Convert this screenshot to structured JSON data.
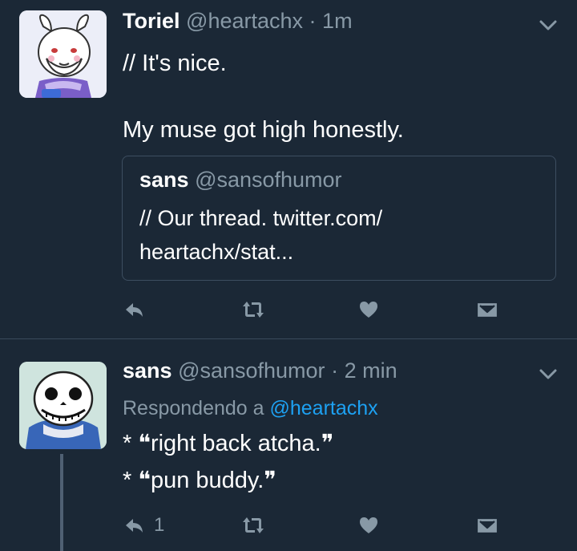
{
  "tweets": [
    {
      "name": "Toriel",
      "handle": "@heartachx",
      "separator": "·",
      "time": "1m",
      "text_line1": "// It's nice.",
      "text_line2": "My muse got high honestly.",
      "quote": {
        "name": "sans",
        "handle": "@sansofhumor",
        "text_line1": "// Our thread. twitter.com/",
        "text_line2": "heartachx/stat..."
      }
    },
    {
      "name": "sans",
      "handle": "@sansofhumor",
      "separator": "·",
      "time": "2 min",
      "reply_prefix": "Respondendo a",
      "reply_mention": "@heartachx",
      "text_line1": "* ❝right back atcha.❞",
      "text_line2": "* ❝pun buddy.❞",
      "reply_count": "1"
    }
  ],
  "icons": [
    "chevron-down-icon",
    "reply-icon",
    "retweet-icon",
    "heart-icon",
    "direct-message-icon"
  ],
  "colors": {
    "background": "#1b2836",
    "secondary_text": "#8899a6",
    "link": "#1da1f2"
  }
}
